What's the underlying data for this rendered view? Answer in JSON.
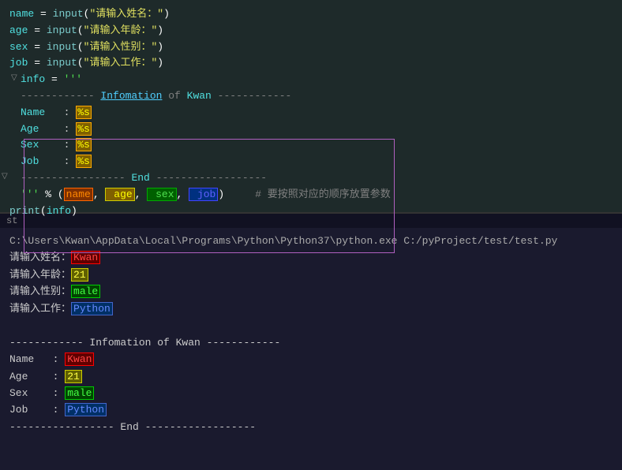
{
  "editor": {
    "lines": [
      {
        "id": "l1",
        "content": "name = input(\"请输入姓名：\")"
      },
      {
        "id": "l2",
        "content": "age = input(\"请输入年龄：\")"
      },
      {
        "id": "l3",
        "content": "sex = input(\"请输入性别：\")"
      },
      {
        "id": "l4",
        "content": "job = input(\"请输入工作：\")"
      },
      {
        "id": "l5",
        "content": "info = '''"
      },
      {
        "id": "l6",
        "content": "------------ Infomation of Kwan ------------"
      },
      {
        "id": "l7",
        "content": "Name   : %s"
      },
      {
        "id": "l8",
        "content": "Age    : %s"
      },
      {
        "id": "l9",
        "content": "Sex    : %s"
      },
      {
        "id": "l10",
        "content": "Job    : %s"
      },
      {
        "id": "l11",
        "content": "----------------- End ------------------"
      },
      {
        "id": "l12",
        "content": "''' % (name,  age,  sex,  job)     # 要按照对应的顺序放置参数"
      },
      {
        "id": "l13",
        "content": "print(info)"
      }
    ]
  },
  "terminal": {
    "path": "C:\\Users\\Kwan\\AppData\\Local\\Programs\\Python\\Python37\\python.exe C:/pyProject/test/test.py",
    "prompts": [
      {
        "label": "请输入姓名：",
        "value": "Kwan"
      },
      {
        "label": "请输入年龄：",
        "value": "21"
      },
      {
        "label": "请输入性别：",
        "value": "male"
      },
      {
        "label": "请输入工作：",
        "value": "Python"
      }
    ],
    "output": {
      "dashes_top": "------------ Infomation of Kwan ------------",
      "name_label": "Name",
      "name_val": "Kwan",
      "age_label": "Age",
      "age_val": "21",
      "sex_label": "Sex",
      "sex_val": "male",
      "job_label": "Job",
      "job_val": "Python",
      "dashes_bot": "----------------- End ------------------"
    }
  },
  "tab": {
    "label": "st"
  }
}
